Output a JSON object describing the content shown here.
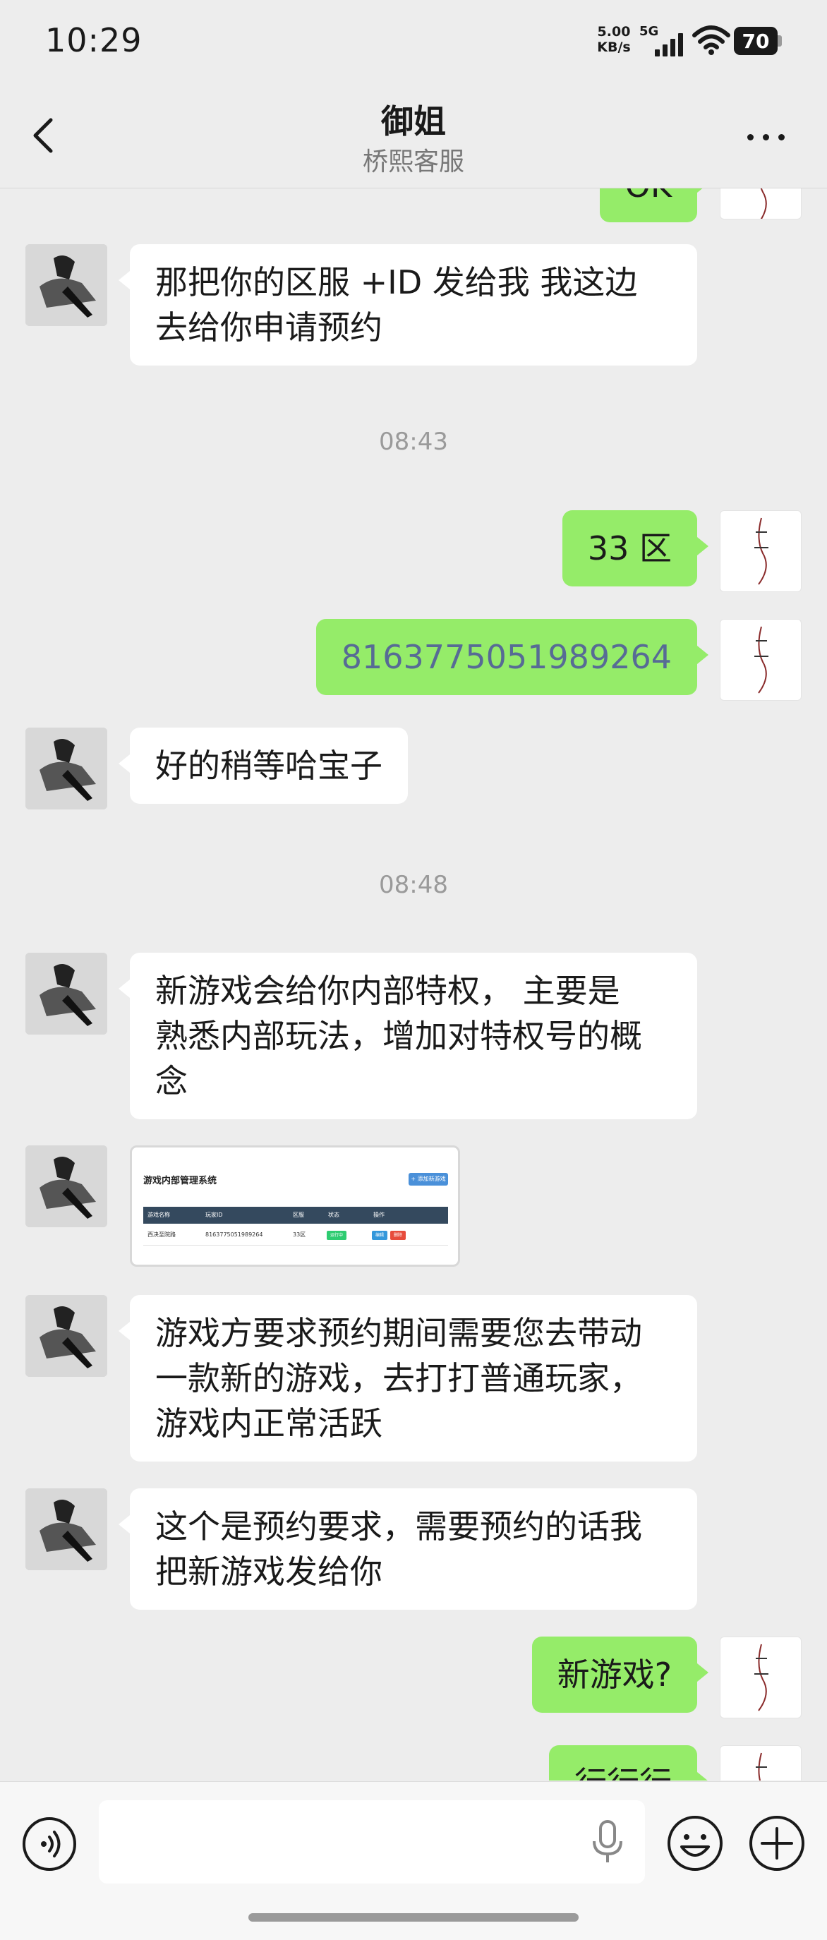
{
  "status_bar": {
    "time": "10:29",
    "net_speed_value": "5.00",
    "net_speed_unit": "KB/s",
    "network_type": "5G",
    "battery": "70"
  },
  "header": {
    "title": "御姐",
    "subtitle": "桥熙客服"
  },
  "chat": {
    "partial_top": "OK",
    "messages": [
      {
        "text": "那把你的区服 +ID 发给我 我这边\n去给你申请预约"
      },
      {
        "time": "08:43"
      },
      {
        "text": "33 区"
      },
      {
        "text": "8163775051989264"
      },
      {
        "text": "好的稍等哈宝子"
      },
      {
        "time": "08:48"
      },
      {
        "text": "新游戏会给你内部特权， 主要是\n熟悉内部玩法，增加对特权号的概\n念"
      },
      {
        "image_title": "游戏内部管理系统",
        "image_button": "+ 添加新游戏",
        "image_headers": [
          "游戏名称",
          "玩家ID",
          "区服",
          "状态",
          "操作"
        ],
        "image_row": [
          "西决至院路",
          "8163775051989264",
          "33区"
        ],
        "image_status": "运行中",
        "image_edit": "编辑",
        "image_delete": "删除"
      },
      {
        "text": "游戏方要求预约期间需要您去带动\n一款新的游戏，去打打普通玩家，\n游戏内正常活跃"
      },
      {
        "text": "这个是预约要求，需要预约的话我\n把新游戏发给你"
      },
      {
        "text": "新游戏?"
      },
      {
        "text": "行行行"
      }
    ]
  },
  "input": {
    "value": "",
    "placeholder": ""
  },
  "colors": {
    "background": "#ededed",
    "self_bubble": "#95ec69",
    "other_bubble": "#ffffff",
    "link_number": "#576b95",
    "timestamp": "#9a9a9a"
  }
}
